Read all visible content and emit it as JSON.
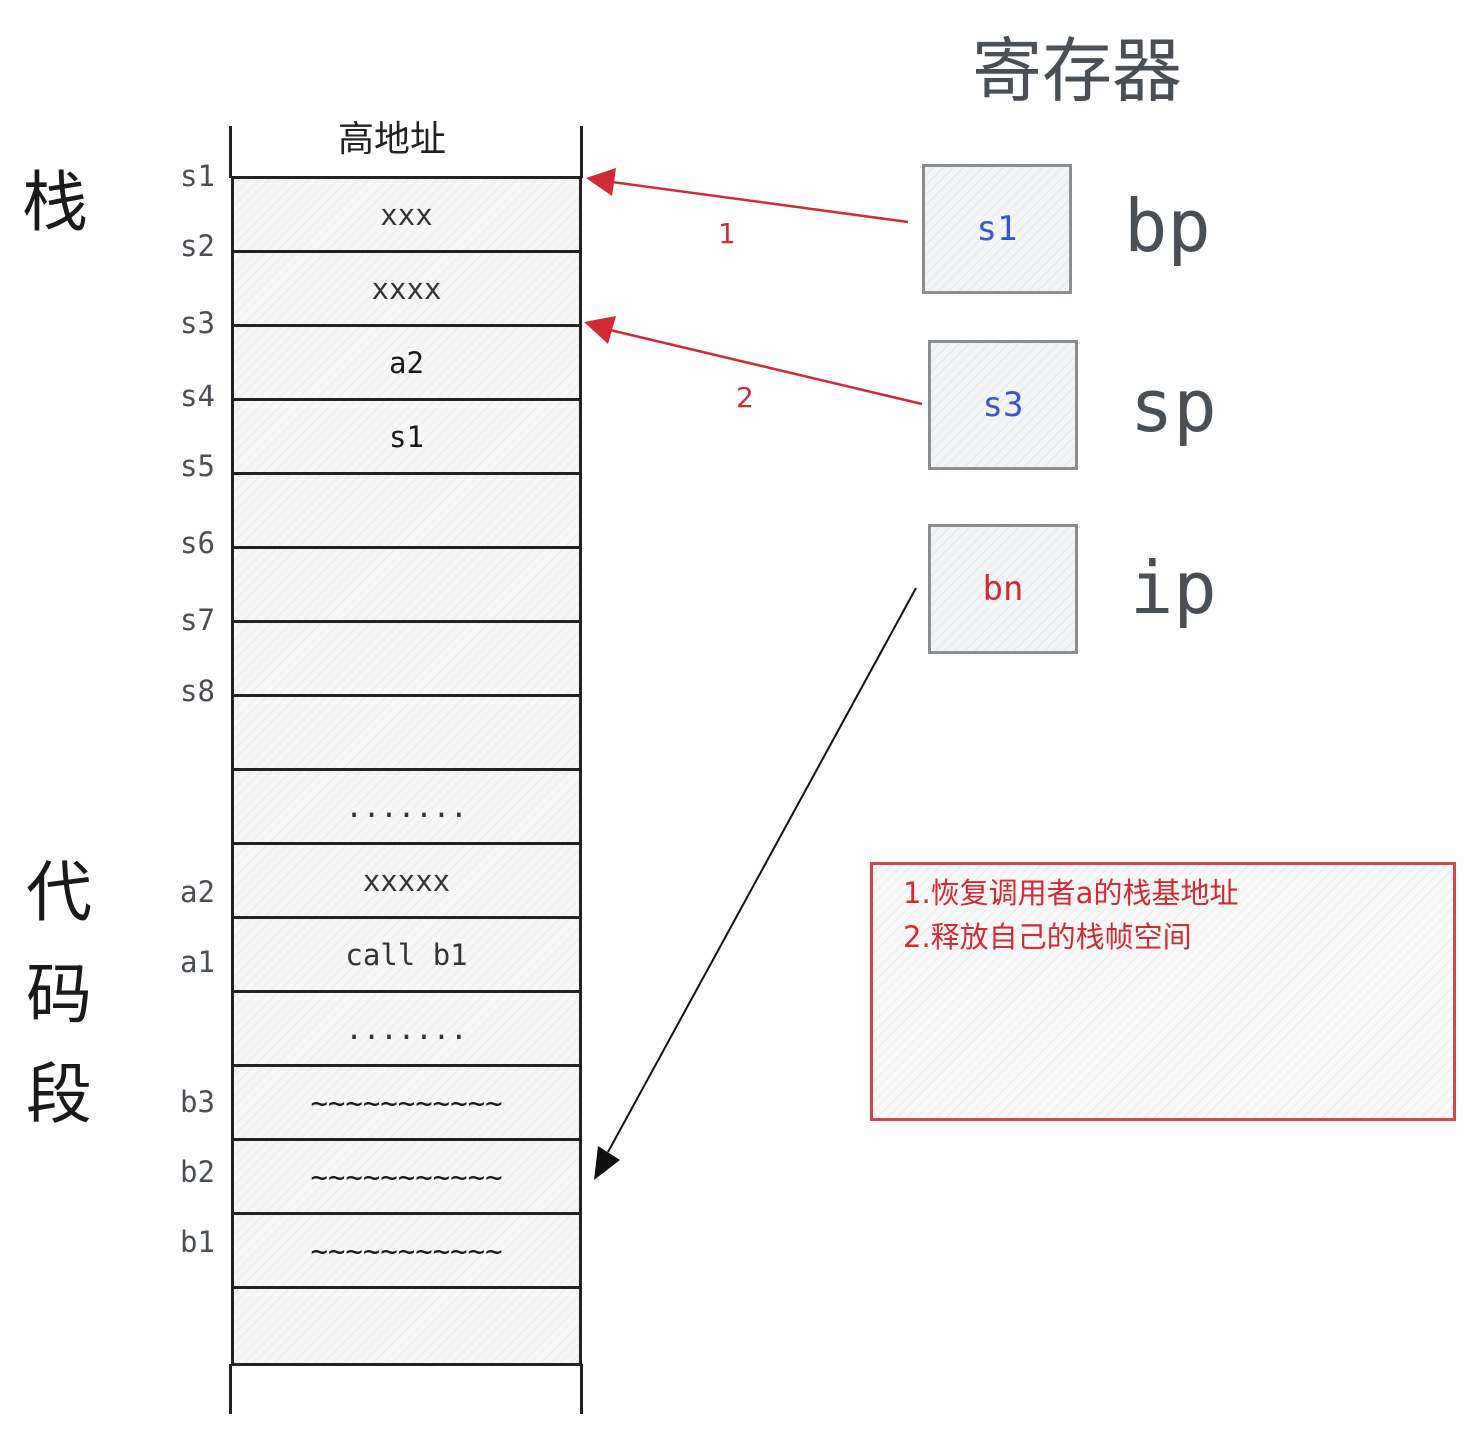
{
  "title": "寄存器",
  "sections": {
    "stack": "栈",
    "code": [
      "代",
      "码",
      "段"
    ]
  },
  "stack_header": "高地址",
  "address_labels": [
    "s1",
    "s2",
    "s3",
    "s4",
    "s5",
    "s6",
    "s7",
    "s8",
    "a2",
    "a1",
    "b3",
    "b2",
    "b1"
  ],
  "cells": [
    {
      "text": "xxx"
    },
    {
      "text": "xxxx"
    },
    {
      "text": "a2"
    },
    {
      "text": "s1"
    },
    {
      "text": ""
    },
    {
      "text": ""
    },
    {
      "text": ""
    },
    {
      "text": ""
    },
    {
      "text": "......."
    },
    {
      "text": "xxxxx"
    },
    {
      "text": "call b1"
    },
    {
      "text": "......."
    },
    {
      "text": "~~~~~~~~~~~"
    },
    {
      "text": "~~~~~~~~~~~"
    },
    {
      "text": "~~~~~~~~~~~"
    },
    {
      "text": ""
    }
  ],
  "registers": [
    {
      "name": "bp",
      "value": "s1",
      "value_color": "#3a55d4"
    },
    {
      "name": "sp",
      "value": "s3",
      "value_color": "#3a55d4"
    },
    {
      "name": "ip",
      "value": "bn",
      "value_color": "#d12b35"
    }
  ],
  "arrows": [
    {
      "label": "1",
      "from": "bp",
      "to": "s1",
      "color": "#d12b35"
    },
    {
      "label": "2",
      "from": "sp",
      "to": "s3",
      "color": "#d12b35"
    },
    {
      "from": "ip",
      "to": "b2",
      "color": "#111111"
    }
  ],
  "note": [
    "1.恢复调用者a的栈基地址",
    "2.释放自己的栈帧空间"
  ]
}
